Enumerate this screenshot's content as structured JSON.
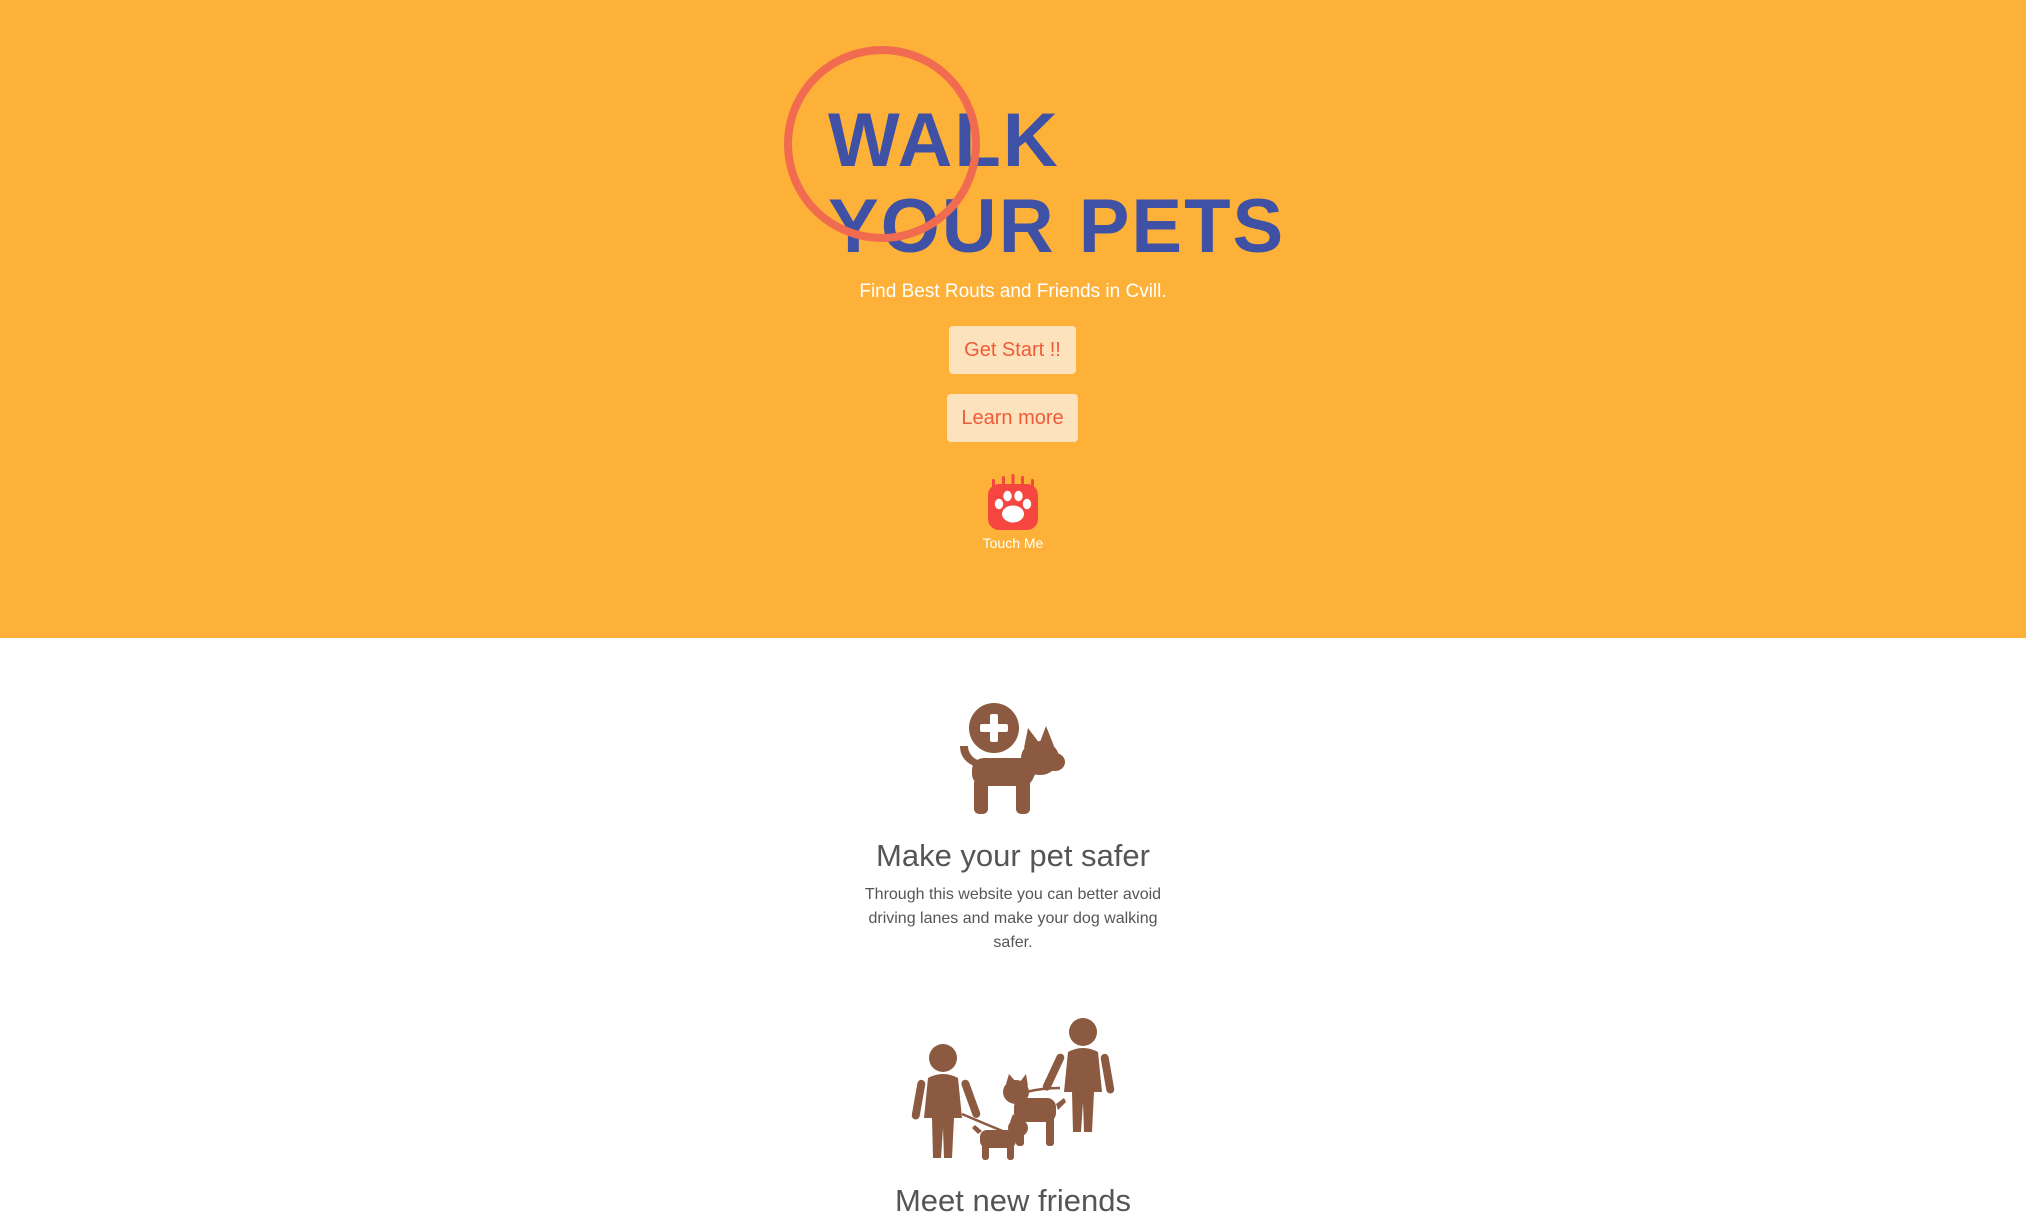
{
  "hero": {
    "title_line1": "WALK",
    "title_line2": "YOUR PETS",
    "subtitle": "Find Best Routs and Friends in Cvill.",
    "get_start_label": "Get Start !!",
    "learn_more_label": "Learn more",
    "paw_icon": "paw-icon",
    "paw_label": "Touch Me"
  },
  "features": [
    {
      "icon": "pet-safety-icon",
      "title": "Make your pet safer",
      "text": "Through this website you can better avoid driving lanes and make your dog walking safer."
    },
    {
      "icon": "people-walking-dogs-icon",
      "title": "Meet new friends"
    }
  ],
  "colors": {
    "hero_background": "#fdb139",
    "title": "#3f51a4",
    "circle": "#f06b4f",
    "button_background": "#fde3bd",
    "button_text": "#f05a37",
    "paw": "#f5473f",
    "feature_icon": "#8b5a40",
    "feature_text": "#555555"
  }
}
